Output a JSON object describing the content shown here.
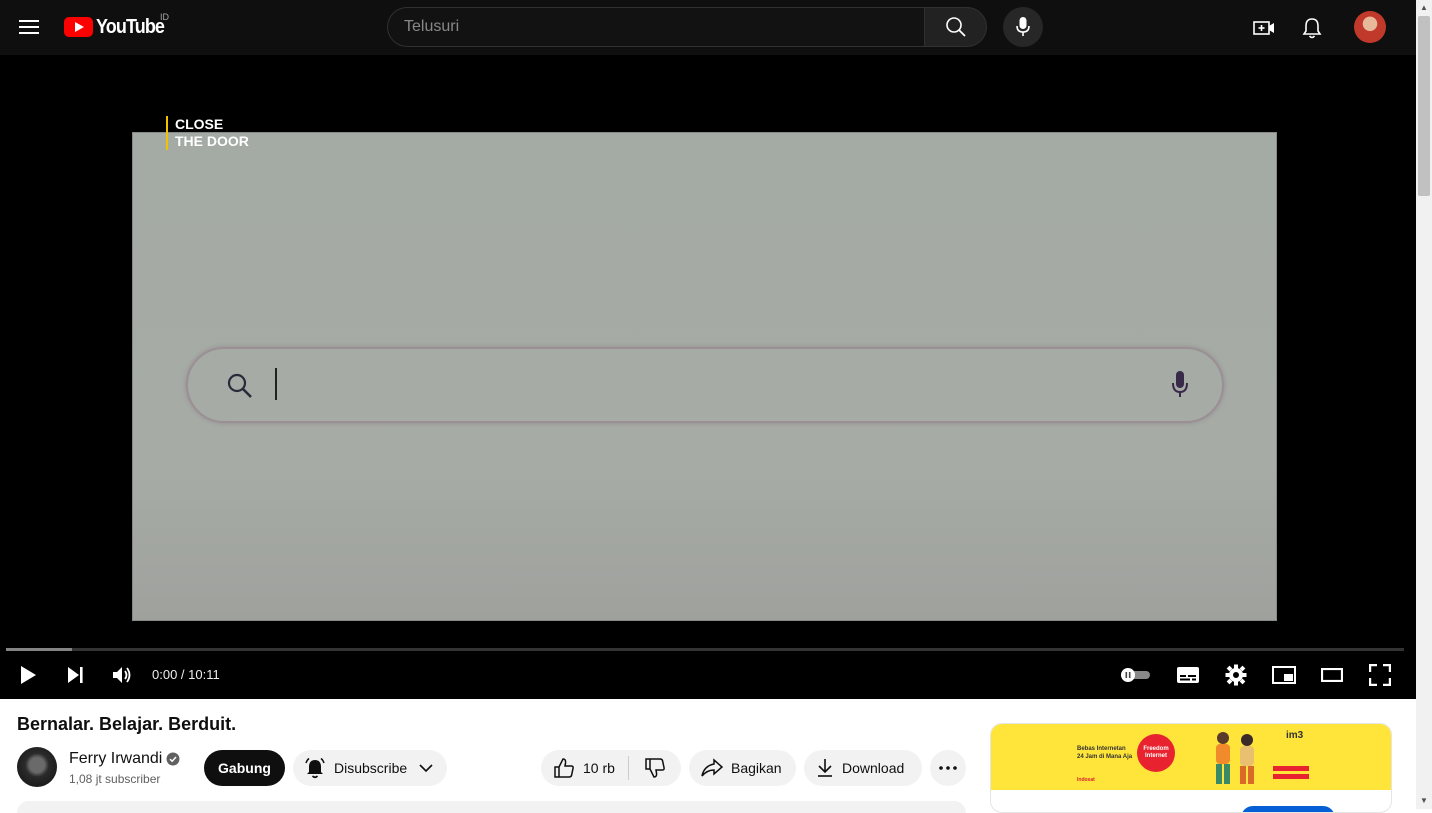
{
  "header": {
    "logo_text": "YouTube",
    "country_code": "ID",
    "search_placeholder": "Telusuri"
  },
  "video": {
    "brand_tag_line1": "CLOSE",
    "brand_tag_line2": "THE DOOR",
    "time_display": "0:00 / 10:11",
    "progress_fraction": 0,
    "buffered_fraction": 0.047
  },
  "info": {
    "title": "Bernalar. Belajar. Berduit.",
    "channel_name": "Ferry Irwandi",
    "subscribers": "1,08 jt subscriber",
    "join_label": "Gabung",
    "subscribe_label": "Disubscribe",
    "like_count": "10 rb",
    "share_label": "Bagikan",
    "download_label": "Download"
  },
  "ad": {
    "headline_line1": "Bebas Internetan",
    "headline_line2": "24 Jam di Mana Aja",
    "circle_text_line1": "Freedom",
    "circle_text_line2": "Internet",
    "brand": "im3",
    "sponsor": "Indosat"
  },
  "colors": {
    "youtube_red": "#ff0000",
    "topbar_bg": "#0f0f0f",
    "ad_yellow": "#ffe43a",
    "ad_red": "#e8232f"
  }
}
